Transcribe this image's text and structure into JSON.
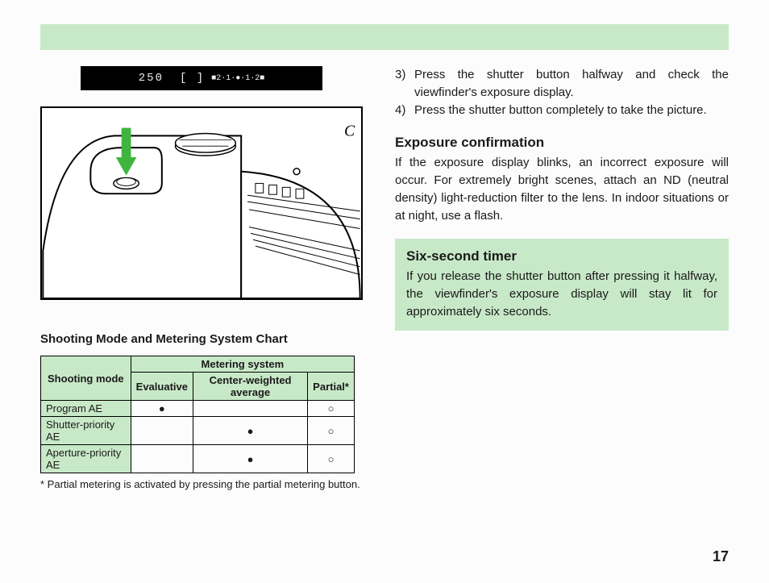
{
  "lcd": {
    "shutter_value": "250",
    "aperture_value": "[ ]",
    "scale_text": "■2·1·●·1·2■"
  },
  "chart": {
    "title": "Shooting Mode and Metering System Chart",
    "header_mode": "Shooting mode",
    "header_group": "Metering system",
    "columns": [
      "Evaluative",
      "Center-weighted average",
      "Partial*"
    ],
    "rows": [
      {
        "mode": "Program AE",
        "cells": [
          "●",
          "",
          "○"
        ]
      },
      {
        "mode": "Shutter-priority AE",
        "cells": [
          "",
          "●",
          "○"
        ]
      },
      {
        "mode": "Aperture-priority AE",
        "cells": [
          "",
          "●",
          "○"
        ]
      }
    ],
    "footnote": "* Partial metering is activated by pressing the partial metering button."
  },
  "steps": [
    {
      "num": "3)",
      "text": "Press the shutter button halfway and check the viewfinder's exposure display."
    },
    {
      "num": "4)",
      "text": "Press the shutter button completely to take the picture."
    }
  ],
  "exposure": {
    "heading": "Exposure confirmation",
    "body": "If the exposure display blinks, an incorrect exposure will occur. For extremely bright scenes, attach an ND (neutral density) light-reduction filter to the lens. In indoor situations or at night, use a flash."
  },
  "timer": {
    "heading": "Six-second timer",
    "body": "If you release the shutter button after pressing it halfway, the viewfinder's exposure display will stay lit for approximately six seconds."
  },
  "page_number": "17"
}
